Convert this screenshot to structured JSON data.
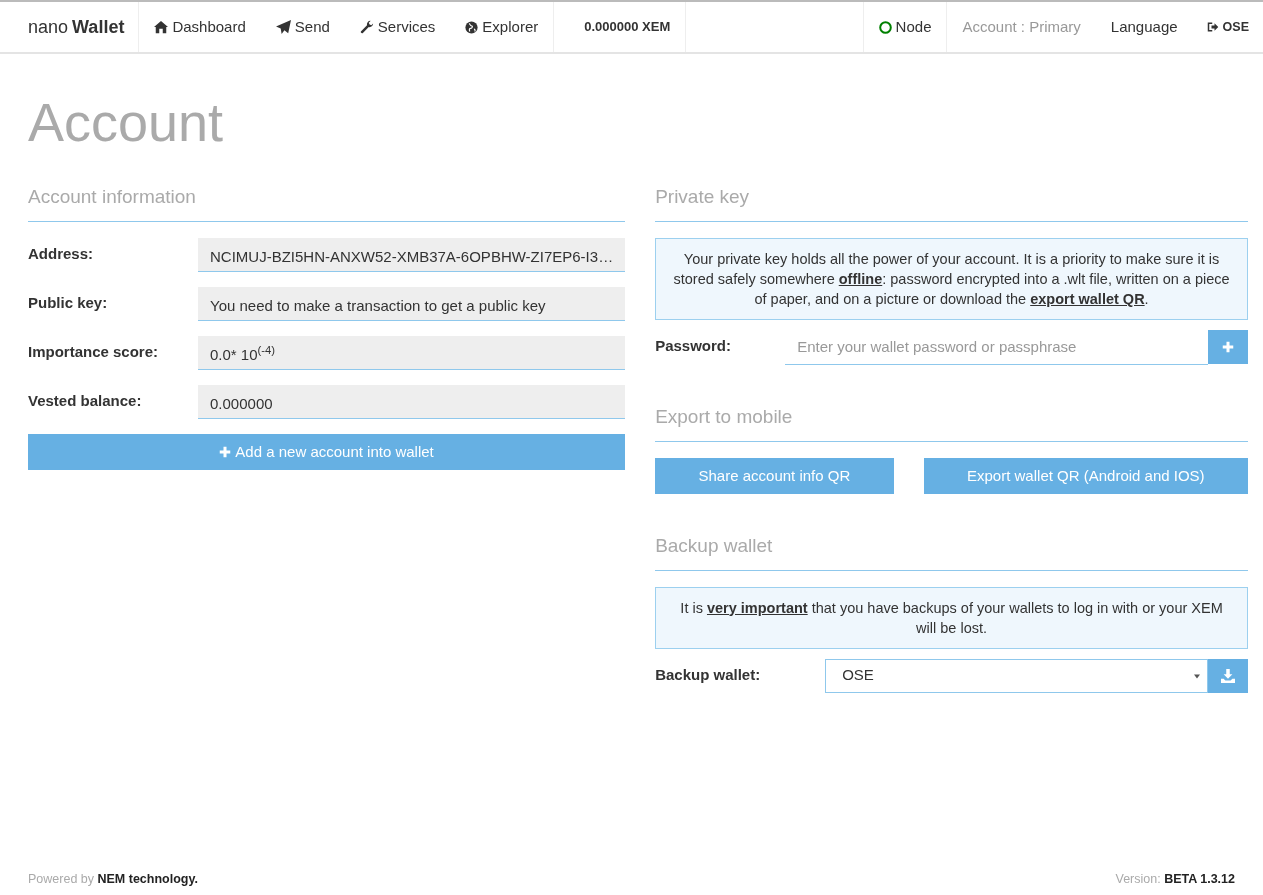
{
  "navbar": {
    "brand_light": "nano",
    "brand_bold": "Wallet",
    "items": [
      {
        "label": "Dashboard"
      },
      {
        "label": "Send"
      },
      {
        "label": "Services"
      },
      {
        "label": "Explorer"
      }
    ],
    "balance": "0.000000 XEM",
    "node": {
      "label": "Node",
      "color": "#008000"
    },
    "account": "Account : Primary",
    "language": "Language",
    "logout": "OSE"
  },
  "page_title": "Account",
  "account_information": {
    "heading": "Account information",
    "fields": [
      {
        "label": "Address:",
        "value": "NCIMUJ-BZI5HN-ANXW52-XMB37A-6OPBHW-ZI7EP6-I3…"
      },
      {
        "label": "Public key:",
        "value": "You need to make a transaction to get a public key"
      },
      {
        "label": "Importance score:",
        "value": "0.0* 10$^{(-4)}$"
      },
      {
        "label": "Vested balance:",
        "value": "0.000000"
      }
    ],
    "add_button": "Add a new account into wallet"
  },
  "private_key": {
    "heading": "Private key",
    "notice": [
      {
        "kind": "text",
        "text": "Your private key holds all the power of your account. It is a priority to make sure it is stored safely somewhere "
      },
      {
        "kind": "link",
        "text": "offline"
      },
      {
        "kind": "text",
        "text": ": password encrypted into a .wlt file, written on a piece of paper, and on a picture or download the "
      },
      {
        "kind": "link",
        "text": "export wallet QR"
      },
      {
        "kind": "text",
        "text": "."
      }
    ],
    "password_label": "Password:",
    "password_placeholder": "Enter your wallet password or passphrase"
  },
  "export_to_mobile": {
    "heading": "Export to mobile",
    "buttons": [
      "Share account info QR",
      "Export wallet QR (Android and IOS)"
    ]
  },
  "backup_wallet": {
    "heading": "Backup wallet",
    "notice": [
      {
        "kind": "text",
        "text": "It is "
      },
      {
        "kind": "link",
        "text": "very important"
      },
      {
        "kind": "text",
        "text": " that you have backups of your wallets to log in with or your XEM will be lost."
      }
    ],
    "label": "Backup wallet:",
    "value": "OSE"
  },
  "footer": {
    "left": "Powered by **NEM technology.**",
    "right": "Version: **BETA 1.3.12**"
  }
}
